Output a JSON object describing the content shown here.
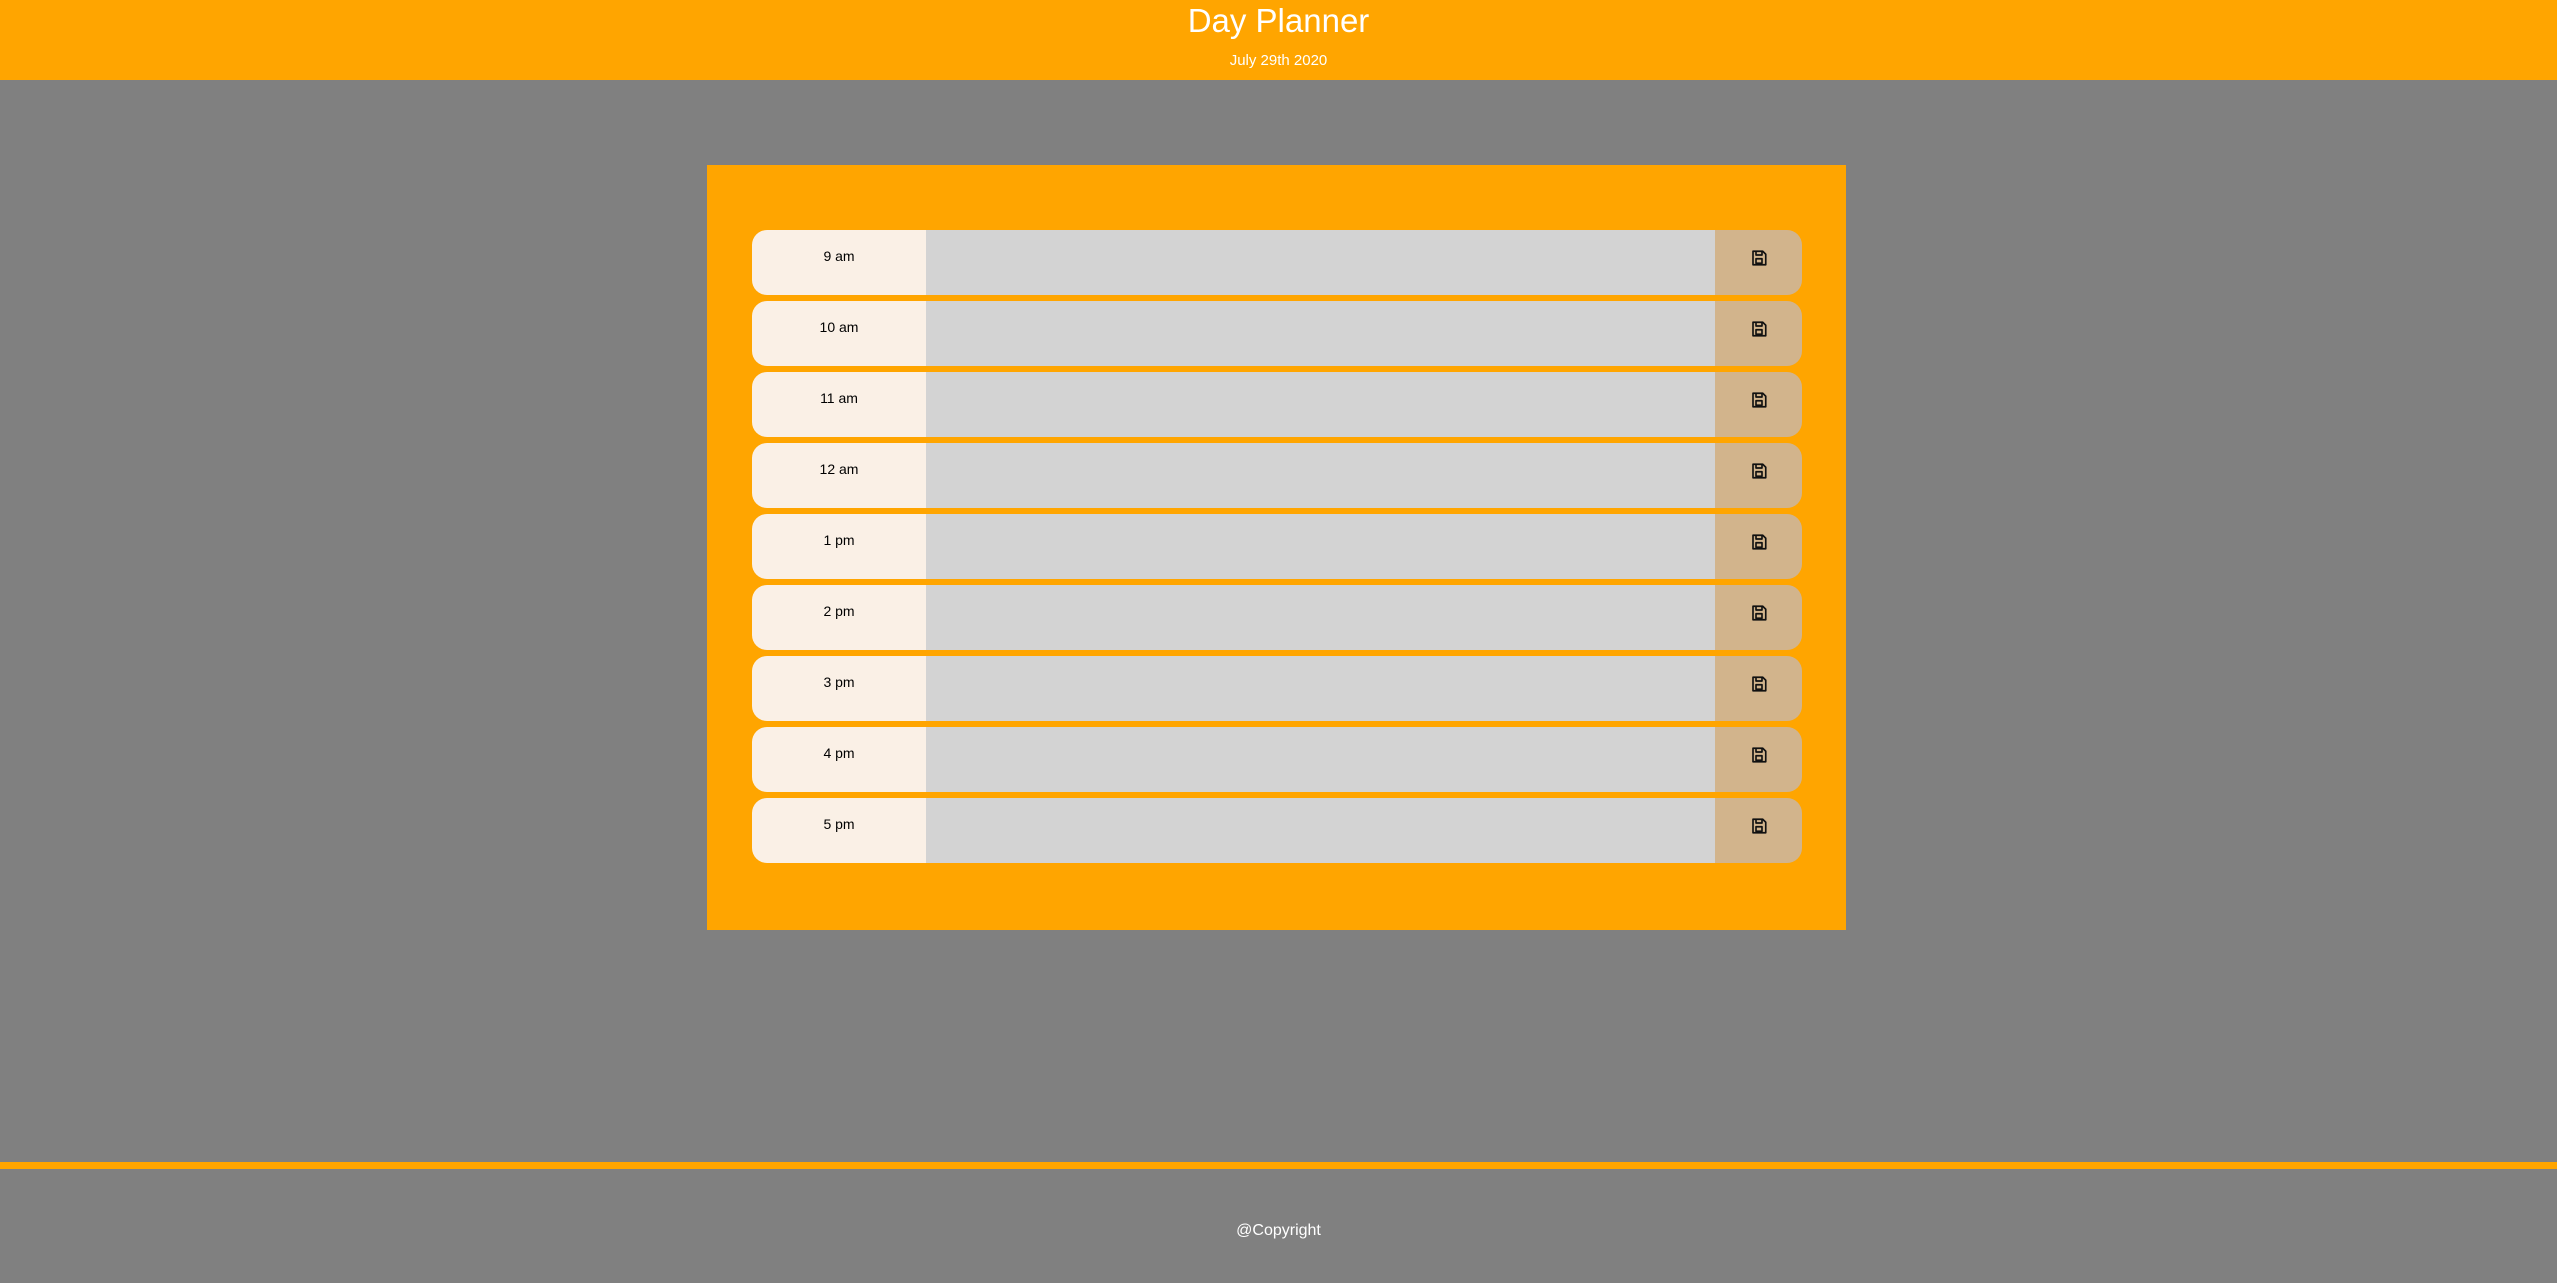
{
  "header": {
    "title": "Day Planner",
    "date": "July 29th 2020"
  },
  "planner": {
    "rows": [
      {
        "hour": "9 am",
        "text": ""
      },
      {
        "hour": "10 am",
        "text": ""
      },
      {
        "hour": "11 am",
        "text": ""
      },
      {
        "hour": "12 am",
        "text": ""
      },
      {
        "hour": "1 pm",
        "text": ""
      },
      {
        "hour": "2 pm",
        "text": ""
      },
      {
        "hour": "3 pm",
        "text": ""
      },
      {
        "hour": "4 pm",
        "text": ""
      },
      {
        "hour": "5 pm",
        "text": ""
      }
    ],
    "save_icon": "save-icon"
  },
  "footer": {
    "text": "@Copyright"
  },
  "colors": {
    "accent": "#ffa500",
    "background": "#808080",
    "hour_bg": "#faf0e6",
    "textarea_bg": "#d3d3d3",
    "save_bg": "#d2b48c"
  }
}
